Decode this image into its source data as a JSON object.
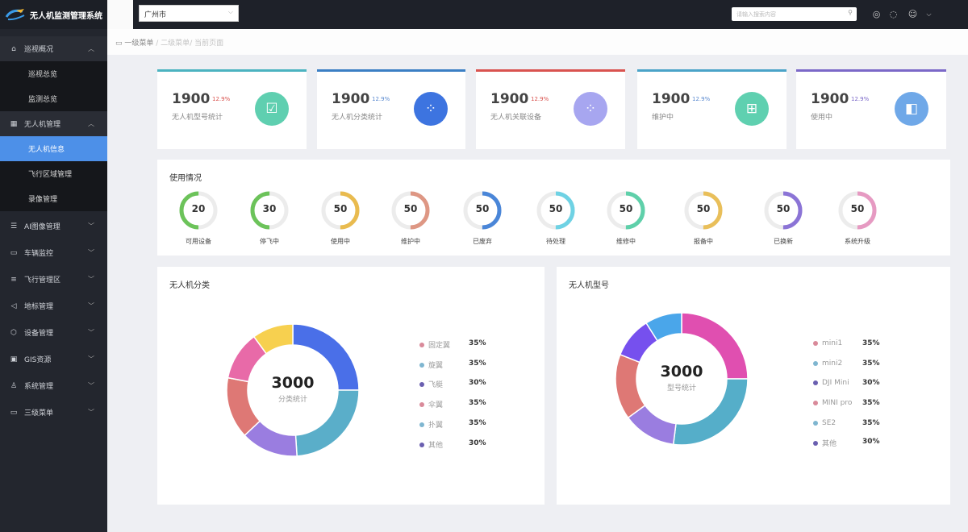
{
  "app": {
    "title": "无人机监测管理系统"
  },
  "sidebar": {
    "groups": [
      {
        "label": "巡视概况",
        "icon": "home-icon",
        "expanded": true,
        "children": [
          "巡视总览",
          "监测总览"
        ]
      },
      {
        "label": "无人机管理",
        "icon": "grid-icon",
        "expanded": true,
        "children": [
          "无人机信息",
          "飞行区域管理",
          "录像管理"
        ],
        "active": "无人机信息"
      },
      {
        "label": "AI图像管理",
        "icon": "image-icon"
      },
      {
        "label": "车辆监控",
        "icon": "camera-icon"
      },
      {
        "label": "飞行管理区",
        "icon": "list-icon"
      },
      {
        "label": "地标管理",
        "icon": "navigation-icon"
      },
      {
        "label": "设备管理",
        "icon": "device-icon"
      },
      {
        "label": "GIS资源",
        "icon": "map-icon"
      },
      {
        "label": "系统管理",
        "icon": "user-icon"
      },
      {
        "label": "三级菜单",
        "icon": "folder-icon"
      }
    ]
  },
  "header": {
    "city": "广州市",
    "search_placeholder": "请输入搜索内容",
    "icons": [
      "settings-icon",
      "notification-icon",
      "user-avatar-icon",
      "chevron-down-icon"
    ]
  },
  "breadcrumb": [
    "一级菜单",
    "二级菜单",
    "当前页面"
  ],
  "stats": [
    {
      "value": "1900",
      "change": "12.9%",
      "label": "无人机型号统计",
      "color": "#4bb3c0",
      "change_color": "#d9534f",
      "icon": "card-check-icon",
      "badge": "#5fcfb0"
    },
    {
      "value": "1900",
      "change": "12.9%",
      "label": "无人机分类统计",
      "color": "#3b7fc4",
      "change_color": "#5b8ad0",
      "icon": "dots-wave-icon",
      "badge": "#3d74e0"
    },
    {
      "value": "1900",
      "change": "12.9%",
      "label": "无人机关联设备",
      "color": "#d9534f",
      "change_color": "#d9534f",
      "icon": "dots-wave-icon",
      "badge": "#a7a6f0"
    },
    {
      "value": "1900",
      "change": "12.9%",
      "label": "维护中",
      "color": "#4aa3c8",
      "change_color": "#5b8ad0",
      "icon": "org-chart-icon",
      "badge": "#5fd0b0"
    },
    {
      "value": "1900",
      "change": "12.9%",
      "label": "使用中",
      "color": "#7b68c8",
      "change_color": "#7b68c8",
      "icon": "box-icon",
      "badge": "#6fa8e8"
    }
  ],
  "usage": {
    "title": "使用情况",
    "items": [
      {
        "value": "20",
        "label": "可用设备",
        "color": "#6cc35a",
        "percent": 50,
        "side": "left"
      },
      {
        "value": "30",
        "label": "停飞中",
        "color": "#6cc35a",
        "percent": 50,
        "side": "left"
      },
      {
        "value": "50",
        "label": "使用中",
        "color": "#e9bb4f",
        "percent": 50,
        "side": "right"
      },
      {
        "value": "50",
        "label": "维护中",
        "color": "#de9784",
        "percent": 50,
        "side": "right"
      },
      {
        "value": "50",
        "label": "已废弃",
        "color": "#4a86d8",
        "percent": 50,
        "side": "right"
      },
      {
        "value": "50",
        "label": "待处理",
        "color": "#6fd2e4",
        "percent": 50,
        "side": "right"
      },
      {
        "value": "50",
        "label": "维修中",
        "color": "#5fd0aa",
        "percent": 50,
        "side": "right"
      },
      {
        "value": "50",
        "label": "报备中",
        "color": "#e9bf5a",
        "percent": 50,
        "side": "right"
      },
      {
        "value": "50",
        "label": "已换新",
        "color": "#8b74d6",
        "percent": 50,
        "side": "right"
      },
      {
        "value": "50",
        "label": "系统升级",
        "color": "#e69ac2",
        "percent": 50,
        "side": "right"
      }
    ]
  },
  "chart_data": [
    {
      "type": "pie",
      "title": "无人机分类",
      "center_value": "3000",
      "center_label": "分类统计",
      "slices": [
        {
          "color": "#4a6fe8",
          "value": 25
        },
        {
          "color": "#5aaec9",
          "value": 24
        },
        {
          "color": "#9a7de0",
          "value": 14
        },
        {
          "color": "#de7875",
          "value": 15
        },
        {
          "color": "#e86aa8",
          "value": 12
        },
        {
          "color": "#f7d04f",
          "value": 10
        }
      ],
      "legend": [
        {
          "label": "固定翼",
          "value": "35%",
          "color": "#d98a9a"
        },
        {
          "label": "旋翼",
          "value": "35%",
          "color": "#7fb6d0"
        },
        {
          "label": "飞艇",
          "value": "30%",
          "color": "#6a5fb0"
        },
        {
          "label": "伞翼",
          "value": "35%",
          "color": "#d98a9a"
        },
        {
          "label": "扑翼",
          "value": "35%",
          "color": "#7fb6d0"
        },
        {
          "label": "其他",
          "value": "30%",
          "color": "#6a5fb0"
        }
      ]
    },
    {
      "type": "pie",
      "title": "无人机型号",
      "center_value": "3000",
      "center_label": "型号统计",
      "slices": [
        {
          "color": "#e04fb0",
          "value": 25
        },
        {
          "color": "#55aec9",
          "value": 27
        },
        {
          "color": "#9a7de0",
          "value": 13
        },
        {
          "color": "#de7875",
          "value": 16
        },
        {
          "color": "#7650ee",
          "value": 10
        },
        {
          "color": "#4aa6ea",
          "value": 9
        }
      ],
      "legend": [
        {
          "label": "mini1",
          "value": "35%",
          "color": "#d98a9a"
        },
        {
          "label": "mini2",
          "value": "35%",
          "color": "#7fb6d0"
        },
        {
          "label": "DJI Mini",
          "value": "30%",
          "color": "#6a5fb0"
        },
        {
          "label": "MINI pro",
          "value": "35%",
          "color": "#d98a9a"
        },
        {
          "label": "SE2",
          "value": "35%",
          "color": "#7fb6d0"
        },
        {
          "label": "其他",
          "value": "30%",
          "color": "#6a5fb0"
        }
      ]
    }
  ]
}
